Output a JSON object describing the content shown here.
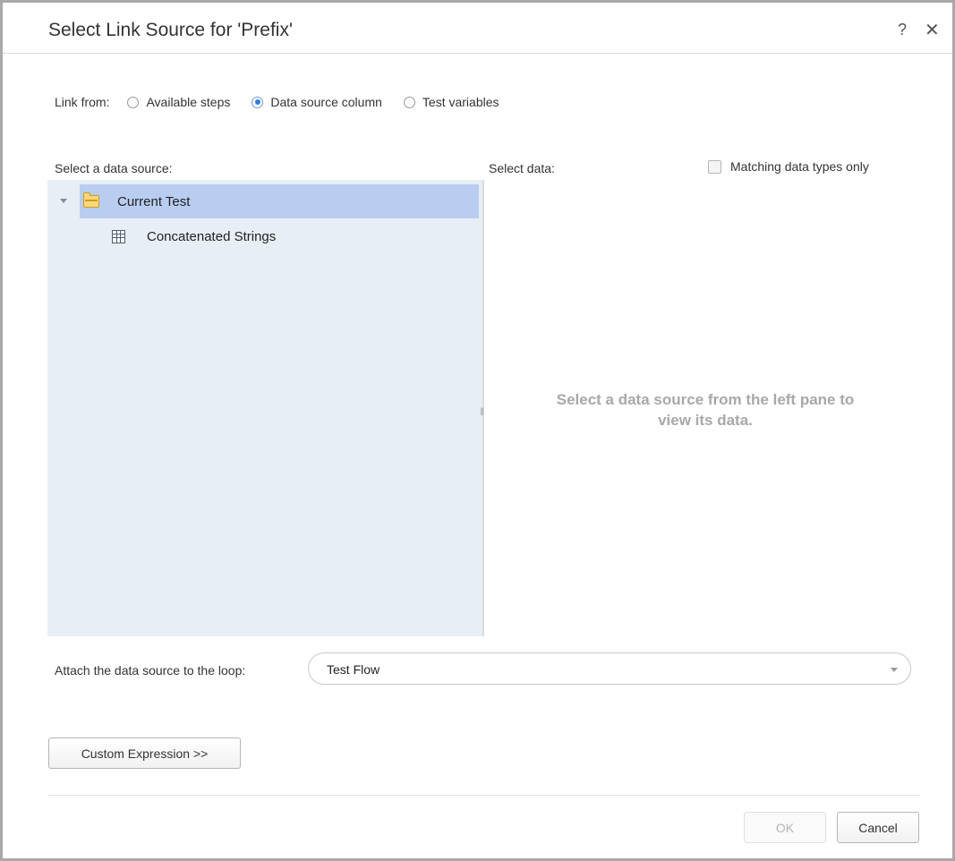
{
  "dialog": {
    "title": "Select Link Source for 'Prefix'",
    "help": "?",
    "close": "✕"
  },
  "link_from": {
    "label": "Link from:",
    "options": [
      {
        "label": "Available steps",
        "checked": false
      },
      {
        "label": "Data source column",
        "checked": true
      },
      {
        "label": "Test variables",
        "checked": false
      }
    ]
  },
  "left_pane": {
    "label": "Select a data source:",
    "tree": [
      {
        "label": "Current Test",
        "icon": "folder-icon",
        "selected": true,
        "expanded": true
      },
      {
        "label": "Concatenated Strings",
        "icon": "table-icon",
        "selected": false
      }
    ]
  },
  "right_pane": {
    "label": "Select data:",
    "matching_label": "Matching data types only",
    "matching_checked": false,
    "empty_line1": "Select a data source from the left pane to",
    "empty_line2": "view its data."
  },
  "attach": {
    "label": "Attach the data source to the loop:",
    "value": "Test Flow"
  },
  "buttons": {
    "custom": "Custom Expression >>",
    "ok": "OK",
    "cancel": "Cancel"
  }
}
